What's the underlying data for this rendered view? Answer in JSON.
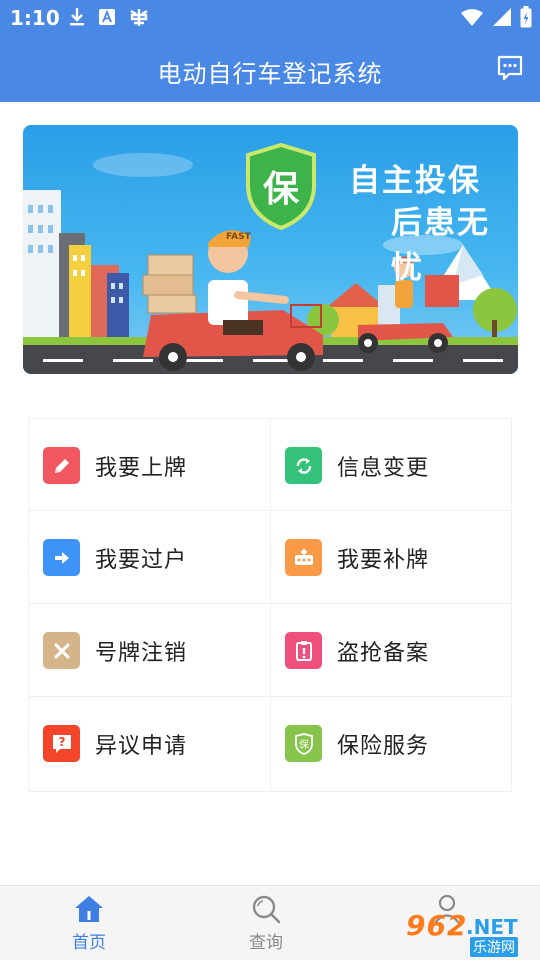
{
  "status": {
    "time": "1:10"
  },
  "header": {
    "title": "电动自行车登记系统"
  },
  "banner": {
    "shield_char": "保",
    "line1": "自主投保",
    "line2": "后患无忧",
    "helmet_text": "FAST"
  },
  "menu": [
    {
      "label": "我要上牌",
      "icon": "pencil-icon",
      "color": "#f2585f"
    },
    {
      "label": "信息变更",
      "icon": "refresh-icon",
      "color": "#35c27a"
    },
    {
      "label": "我要过户",
      "icon": "arrow-right-icon",
      "color": "#3d94f6"
    },
    {
      "label": "我要补牌",
      "icon": "plate-icon",
      "color": "#f89a48"
    },
    {
      "label": "号牌注销",
      "icon": "close-icon",
      "color": "#d4b488"
    },
    {
      "label": "盗抢备案",
      "icon": "clipboard-alert-icon",
      "color": "#ee4f7c"
    },
    {
      "label": "异议申请",
      "icon": "question-icon",
      "color": "#f2452a"
    },
    {
      "label": "保险服务",
      "icon": "insurance-shield-icon",
      "color": "#86c44c"
    }
  ],
  "insurance_icon_char": "保",
  "nav": [
    {
      "label": "首页",
      "active": true
    },
    {
      "label": "查询",
      "active": false
    }
  ],
  "watermark": {
    "num": "962",
    "net": ".NET",
    "cn": "乐游网"
  },
  "colors": {
    "primary": "#4a88e6",
    "nav_active": "#3d7fe2",
    "nav_inactive": "#8a8a8a"
  }
}
